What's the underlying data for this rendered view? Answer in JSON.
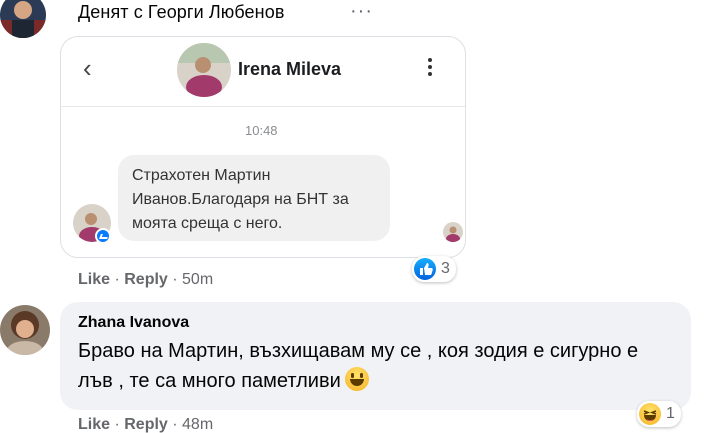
{
  "post_header": {
    "title": "Денят с Георги Любенов",
    "menu_icon": "more-horizontal-icon"
  },
  "screenshot_card": {
    "contact_name": "Irena Mileva",
    "time": "10:48",
    "message_lines": [
      "Страхотен Мартин",
      "Иванов.Благодаря на БНТ за",
      "моята среща с него."
    ],
    "back_icon": "chevron-left-icon",
    "menu_icon": "more-vertical-icon",
    "badge_icon": "messenger-icon"
  },
  "comment_actions_1": {
    "like": "Like",
    "sep1": " · ",
    "reply": "Reply",
    "sep2": " · ",
    "time": "50m"
  },
  "reaction_1": {
    "icon": "like-reaction-icon",
    "count": "3"
  },
  "comment": {
    "author": "Zhana Ivanova",
    "text": "Браво на Мартин, възхищавам му се , коя зодия е сигурно е лъв , те са много паметливи",
    "emoji": "grinning-face-icon"
  },
  "reaction_2": {
    "icon": "haha-reaction-icon",
    "count": "1"
  },
  "comment_actions_2": {
    "like": "Like",
    "sep1": " · ",
    "reply": "Reply",
    "sep2": " · ",
    "time": "48m"
  },
  "colors": {
    "accent_blue": "#0a7cff",
    "bubble_bg": "#f0f2f5",
    "meta_text": "#65676b"
  }
}
